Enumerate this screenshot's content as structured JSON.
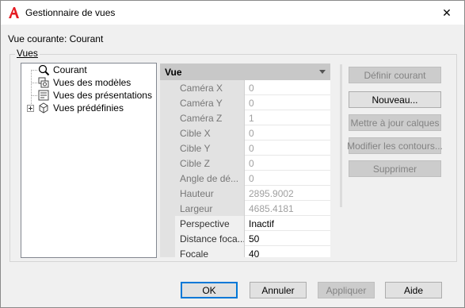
{
  "window": {
    "title": "Gestionnaire de vues",
    "close_glyph": "✕",
    "app_icon": "autocad-a-icon"
  },
  "current_view_text": "Vue courante: Courant",
  "group_label": "Vues",
  "tree": {
    "items": [
      {
        "label": "Courant",
        "icon": "magnifier-icon"
      },
      {
        "label": "Vues des modèles",
        "icon": "model-views-icon"
      },
      {
        "label": "Vues des présentations",
        "icon": "layout-views-icon"
      },
      {
        "label": "Vues prédéfinies",
        "icon": "preset-views-icon"
      }
    ],
    "expander_glyph": "+"
  },
  "properties": {
    "section_title": "Vue",
    "rows": [
      {
        "name": "Caméra X",
        "value": "0",
        "editable": false
      },
      {
        "name": "Caméra Y",
        "value": "0",
        "editable": false
      },
      {
        "name": "Caméra Z",
        "value": "1",
        "editable": false
      },
      {
        "name": "Cible X",
        "value": "0",
        "editable": false
      },
      {
        "name": "Cible Y",
        "value": "0",
        "editable": false
      },
      {
        "name": "Cible Z",
        "value": "0",
        "editable": false
      },
      {
        "name": "Angle de dé...",
        "value": "0",
        "editable": false
      },
      {
        "name": "Hauteur",
        "value": "2895.9002",
        "editable": false
      },
      {
        "name": "Largeur",
        "value": "4685.4181",
        "editable": false
      },
      {
        "name": "Perspective",
        "value": "Inactif",
        "editable": true
      },
      {
        "name": "Distance foca...",
        "value": "50",
        "editable": true
      },
      {
        "name": "Focale",
        "value": "40",
        "editable": true
      }
    ]
  },
  "side_buttons": {
    "set_current": "Définir courant",
    "new": "Nouveau...",
    "update_layers": "Mettre à jour calques",
    "edit_boundaries": "Modifier les contours...",
    "delete": "Supprimer"
  },
  "footer_buttons": {
    "ok": "OK",
    "cancel": "Annuler",
    "apply": "Appliquer",
    "help": "Aide"
  }
}
